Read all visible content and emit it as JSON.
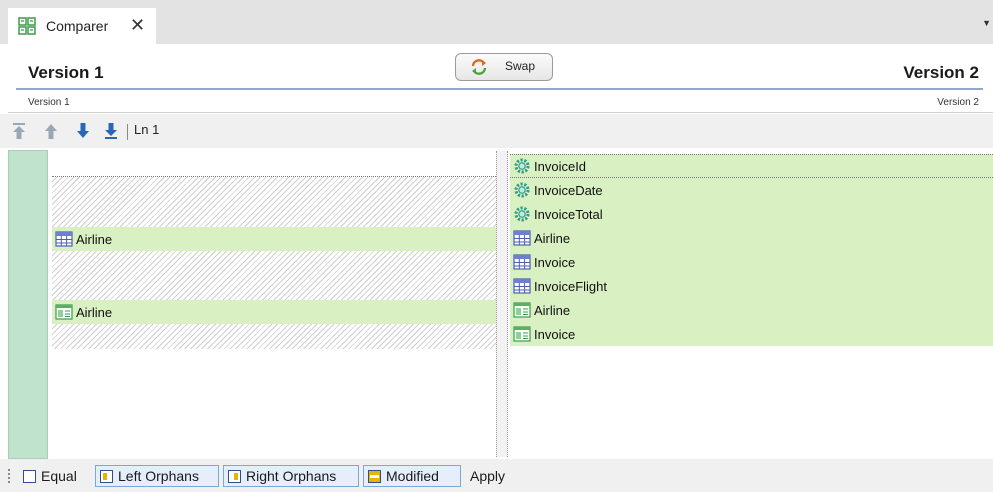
{
  "tab": {
    "title": "Comparer",
    "close_glyph": "✕"
  },
  "header": {
    "left_title": "Version 1",
    "right_title": "Version 2",
    "swap_label": "Swap",
    "left_subtitle": "Version 1",
    "right_subtitle": "Version 2"
  },
  "toolbar": {
    "line_indicator": "Ln 1"
  },
  "left_pane": {
    "rows": [
      {
        "type": "empty-hatched",
        "label": ""
      },
      {
        "type": "hatched",
        "label": ""
      },
      {
        "type": "hatched",
        "label": ""
      },
      {
        "type": "item",
        "icon": "transaction-grid-icon",
        "label": "Airline"
      },
      {
        "type": "hatched",
        "label": ""
      },
      {
        "type": "hatched",
        "label": ""
      },
      {
        "type": "item",
        "icon": "webpanel-icon",
        "label": "Airline"
      },
      {
        "type": "hatched",
        "label": ""
      }
    ]
  },
  "right_pane": {
    "rows": [
      {
        "icon": "attribute-gear-icon",
        "label": "InvoiceId"
      },
      {
        "icon": "attribute-gear-icon",
        "label": "InvoiceDate"
      },
      {
        "icon": "attribute-gear-icon",
        "label": "InvoiceTotal"
      },
      {
        "icon": "transaction-grid-icon",
        "label": "Airline"
      },
      {
        "icon": "transaction-grid-icon",
        "label": "Invoice"
      },
      {
        "icon": "transaction-grid-icon",
        "label": "InvoiceFlight"
      },
      {
        "icon": "webpanel-icon",
        "label": "Airline"
      },
      {
        "icon": "webpanel-icon",
        "label": "Invoice"
      }
    ]
  },
  "legend": {
    "equal": "Equal",
    "left_orphans": "Left Orphans",
    "right_orphans": "Right Orphans",
    "modified": "Modified",
    "apply": "Apply"
  },
  "colors": {
    "green_row": "#d8f0c2",
    "gutter": "#bfe3cd",
    "accent_line": "#8ea8cf",
    "arrow_blue": "#2a66b8"
  }
}
